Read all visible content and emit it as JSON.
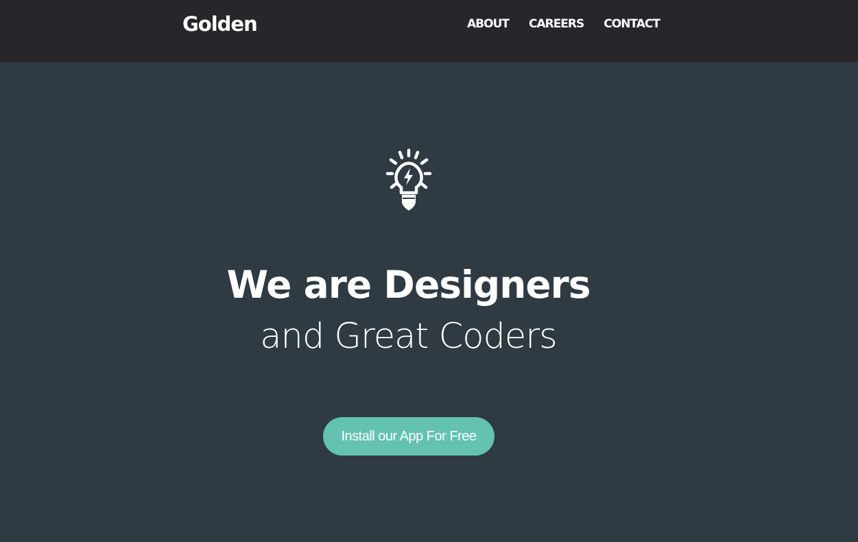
{
  "navbar": {
    "brand": "Golden",
    "links": [
      {
        "label": "ABOUT"
      },
      {
        "label": "CAREERS"
      },
      {
        "label": "CONTACT"
      }
    ]
  },
  "hero": {
    "icon": "lightbulb-icon",
    "headline": "We are Designers",
    "subline": "and Great Coders",
    "cta_label": "Install our App For Free"
  },
  "colors": {
    "navbar_bg": "#27272b",
    "hero_bg": "#2f3a43",
    "accent": "#63c2b1",
    "text": "#ffffff"
  }
}
